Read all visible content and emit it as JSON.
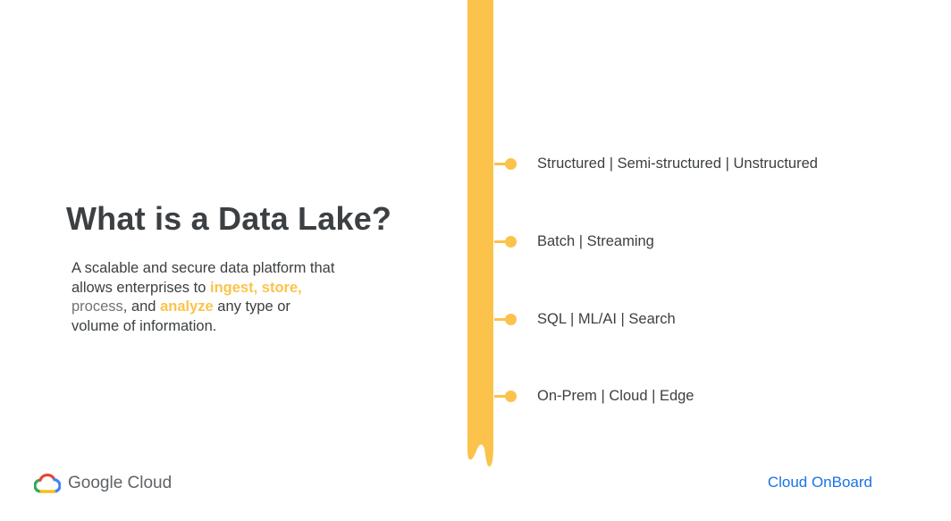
{
  "slide": {
    "title": "What is a Data Lake?",
    "description": {
      "line1": "A scalable and secure data platform that allows enterprises to ",
      "ingest": "ingest,",
      "store": "store,",
      "process": "process",
      "and": ", and ",
      "analyze": "analyze",
      "tail": " any type or volume of information."
    },
    "timeline": [
      {
        "label": "Structured  |  Semi-structured  |  Unstructured"
      },
      {
        "label": "Batch  |  Streaming"
      },
      {
        "label": "SQL  |  ML/AI  |  Search"
      },
      {
        "label": "On-Prem  |  Cloud  |  Edge"
      }
    ]
  },
  "footer": {
    "logo_text": "Google Cloud",
    "brand": "Cloud OnBoard"
  },
  "colors": {
    "accent_yellow": "#fbc34b",
    "text_dark": "#3c4043",
    "brand_blue": "#1a73e8"
  },
  "icons": {
    "logo": "google-cloud-logo-icon"
  }
}
